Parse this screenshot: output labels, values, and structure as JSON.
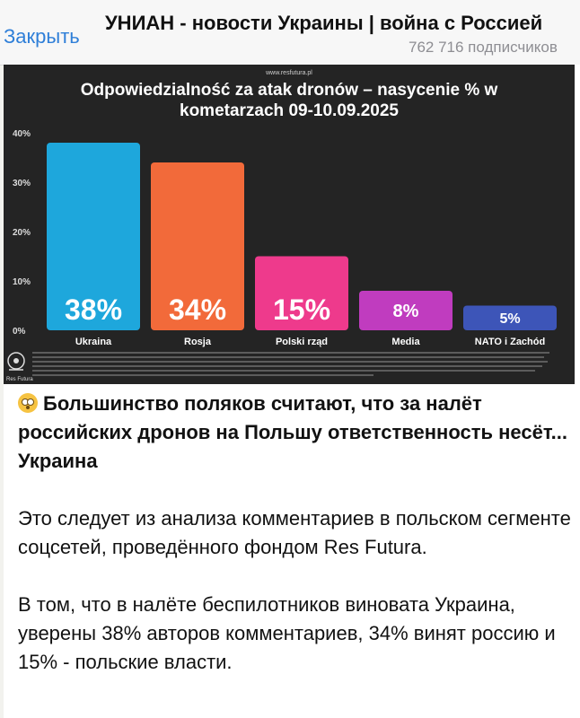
{
  "topbar": {
    "close_label": "Закрыть",
    "channel_title": "УНИАН - новости Украины | война с Россией",
    "subscribers": "762 716 подписчиков"
  },
  "chart_data": {
    "type": "bar",
    "source": "www.resfutura.pl",
    "title_line1": "Odpowiedzialność za atak dronów – nasycenie % w",
    "title_line2": "kometarzach 09-10.09.2025",
    "categories": [
      "Ukraina",
      "Rosja",
      "Polski rząd",
      "Media",
      "NATO i Zachód"
    ],
    "values": [
      38,
      34,
      15,
      8,
      5
    ],
    "value_labels": [
      "38%",
      "34%",
      "15%",
      "8%",
      "5%"
    ],
    "colors": [
      "#1ea7dc",
      "#f26a3a",
      "#ee3a8c",
      "#c03cbf",
      "#3d55b8"
    ],
    "ylim": [
      0,
      40
    ],
    "yticks": [
      0,
      10,
      20,
      30,
      40
    ],
    "ytick_labels": [
      "0%",
      "10%",
      "20%",
      "30%",
      "40%"
    ],
    "grid": false,
    "logo_text": "Res Futura"
  },
  "post": {
    "headline": "Большинство поляков считают, что за налёт российских дронов на Польшу ответственность несёт... Украина",
    "paragraph1": "Это следует из анализа комментариев в польском сегменте соцсетей, проведённого фондом Res Futura.",
    "paragraph2": "В том, что в налёте беспилотников виновата Украина, уверены 38% авторов комментариев, 34% винят россию и 15% - польские власти."
  }
}
